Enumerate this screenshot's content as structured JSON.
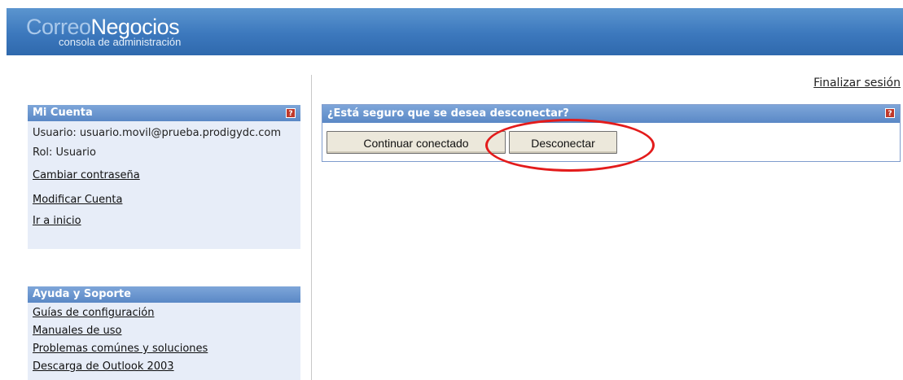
{
  "header": {
    "brand_part1": "Correo",
    "brand_part2": "Negocios",
    "subtitle": "consola de administración"
  },
  "top_links": {
    "logout": "Finalizar sesión"
  },
  "account_panel": {
    "title": "Mi Cuenta",
    "user": "Usuario: usuario.movil@prueba.prodigydc.com",
    "role": "Rol: Usuario",
    "links": [
      "Cambiar contraseña",
      "Modificar Cuenta",
      "Ir a inicio"
    ]
  },
  "support_panel": {
    "title": "Ayuda y Soporte",
    "links": [
      "Guías de configuración",
      "Manuales de uso",
      "Problemas comúnes y soluciones",
      "Descarga de Outlook 2003"
    ]
  },
  "confirm_panel": {
    "title": "¿Está seguro que se desea desconectar?",
    "continue_label": "Continuar conectado",
    "disconnect_label": "Desconectar"
  },
  "icons": {
    "help": "help-icon"
  },
  "colors": {
    "header": "#3c78bd",
    "panel_title": "#5a88c6",
    "panel_bg": "#e7edf8",
    "highlight": "#e31b1b"
  }
}
